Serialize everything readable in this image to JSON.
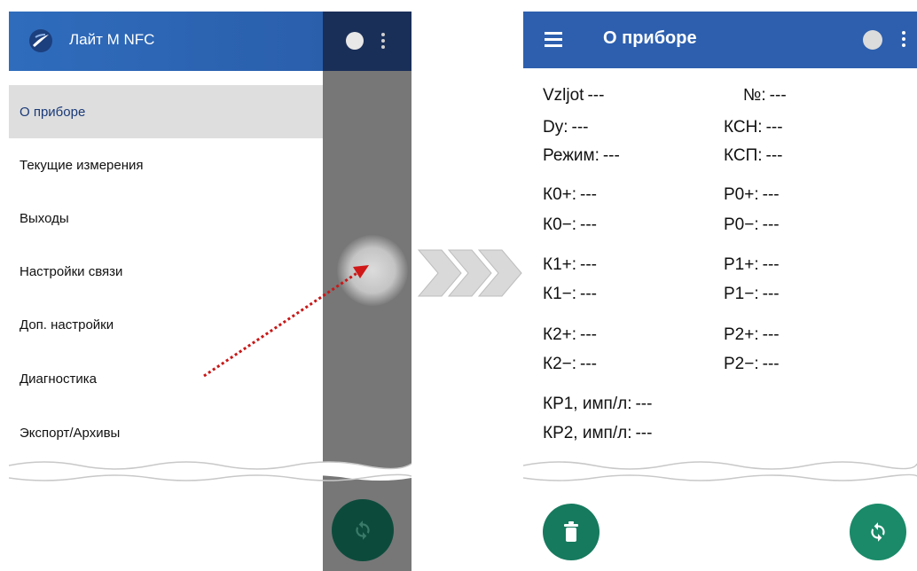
{
  "left_screen": {
    "drawer_title": "Лайт М NFC",
    "menu": [
      {
        "label": "О приборе",
        "selected": true
      },
      {
        "label": "Текущие измерения",
        "selected": false
      },
      {
        "label": "Выходы",
        "selected": false
      },
      {
        "label": "Настройки связи",
        "selected": false
      },
      {
        "label": "Доп. настройки",
        "selected": false
      },
      {
        "label": "Диагностика",
        "selected": false
      },
      {
        "label": "Экспорт/Архивы",
        "selected": false
      }
    ]
  },
  "right_screen": {
    "title": "О приборе",
    "fields": {
      "vzljot": {
        "label": "Vzljot",
        "value": "---"
      },
      "number": {
        "label": "№:",
        "value": "---"
      },
      "dy": {
        "label": "Dy:",
        "value": "---"
      },
      "ksn": {
        "label": "КСН:",
        "value": "---"
      },
      "mode": {
        "label": "Режим:",
        "value": "---"
      },
      "ksp": {
        "label": "КСП:",
        "value": "---"
      },
      "k0p": {
        "label": "К0+:",
        "value": "---"
      },
      "p0p": {
        "label": "Р0+:",
        "value": "---"
      },
      "k0m": {
        "label": "К0−:",
        "value": "---"
      },
      "p0m": {
        "label": "Р0−:",
        "value": "---"
      },
      "k1p": {
        "label": "К1+:",
        "value": "---"
      },
      "p1p": {
        "label": "Р1+:",
        "value": "---"
      },
      "k1m": {
        "label": "К1−:",
        "value": "---"
      },
      "p1m": {
        "label": "Р1−:",
        "value": "---"
      },
      "k2p": {
        "label": "К2+:",
        "value": "---"
      },
      "p2p": {
        "label": "Р2+:",
        "value": "---"
      },
      "k2m": {
        "label": "К2−:",
        "value": "---"
      },
      "p2m": {
        "label": "Р2−:",
        "value": "---"
      },
      "kp1": {
        "label": "КР1, имп/л:",
        "value": "---"
      },
      "kp2": {
        "label": "КР2, имп/л:",
        "value": "---"
      }
    }
  },
  "icons": {
    "logo": "app-logo-icon",
    "menu": "hamburger-menu-icon",
    "status": "status-dot-icon",
    "more": "more-vert-icon",
    "delete": "delete-icon",
    "refresh": "refresh-icon",
    "transition": "chevron-arrows-icon"
  },
  "colors": {
    "app_bar": "#2d5fae",
    "fab": "#1a8a68",
    "selected_item": "#dedede",
    "gesture_arrow": "#d01818"
  }
}
